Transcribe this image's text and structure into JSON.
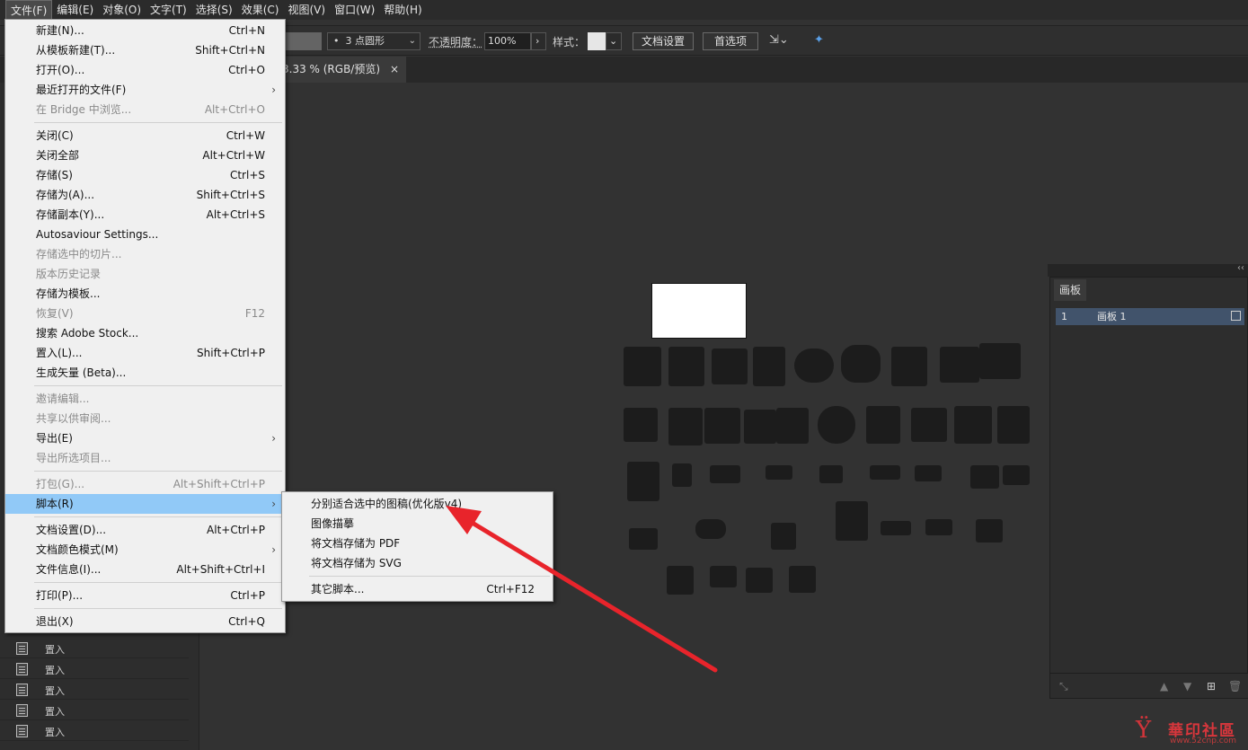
{
  "menubar": {
    "items": [
      "文件(F)",
      "编辑(E)",
      "对象(O)",
      "文字(T)",
      "选择(S)",
      "效果(C)",
      "视图(V)",
      "窗口(W)",
      "帮助(H)"
    ]
  },
  "controlbar": {
    "stroke_profile": "3 点圆形",
    "stroke_bullet": "•",
    "opacity_label": "不透明度：",
    "opacity_value": "100%",
    "style_label": "样式：",
    "doc_setup": "文档设置",
    "preferences": "首选项"
  },
  "document_tab": {
    "title": "3.33 % (RGB/预览)",
    "close": "×"
  },
  "file_menu": {
    "items": [
      {
        "label": "新建(N)...",
        "shortcut": "Ctrl+N"
      },
      {
        "label": "从模板新建(T)...",
        "shortcut": "Shift+Ctrl+N"
      },
      {
        "label": "打开(O)...",
        "shortcut": "Ctrl+O"
      },
      {
        "label": "最近打开的文件(F)",
        "shortcut": ""
      },
      {
        "label": "在 Bridge 中浏览...",
        "shortcut": "Alt+Ctrl+O"
      },
      {
        "label": "关闭(C)",
        "shortcut": "Ctrl+W"
      },
      {
        "label": "关闭全部",
        "shortcut": "Alt+Ctrl+W"
      },
      {
        "label": "存储(S)",
        "shortcut": "Ctrl+S"
      },
      {
        "label": "存储为(A)...",
        "shortcut": "Shift+Ctrl+S"
      },
      {
        "label": "存储副本(Y)...",
        "shortcut": "Alt+Ctrl+S"
      },
      {
        "label": "Autosaviour Settings...",
        "shortcut": ""
      },
      {
        "label": "存储选中的切片...",
        "shortcut": ""
      },
      {
        "label": "版本历史记录",
        "shortcut": ""
      },
      {
        "label": "存储为模板...",
        "shortcut": ""
      },
      {
        "label": "恢复(V)",
        "shortcut": "F12"
      },
      {
        "label": "搜索 Adobe Stock...",
        "shortcut": ""
      },
      {
        "label": "置入(L)...",
        "shortcut": "Shift+Ctrl+P"
      },
      {
        "label": "生成矢量 (Beta)...",
        "shortcut": ""
      },
      {
        "label": "邀请编辑...",
        "shortcut": ""
      },
      {
        "label": "共享以供审阅...",
        "shortcut": ""
      },
      {
        "label": "导出(E)",
        "shortcut": ""
      },
      {
        "label": "导出所选项目...",
        "shortcut": ""
      },
      {
        "label": "打包(G)...",
        "shortcut": "Alt+Shift+Ctrl+P"
      },
      {
        "label": "脚本(R)",
        "shortcut": ""
      },
      {
        "label": "文档设置(D)...",
        "shortcut": "Alt+Ctrl+P"
      },
      {
        "label": "文档颜色模式(M)",
        "shortcut": ""
      },
      {
        "label": "文件信息(I)...",
        "shortcut": "Alt+Shift+Ctrl+I"
      },
      {
        "label": "打印(P)...",
        "shortcut": "Ctrl+P"
      },
      {
        "label": "退出(X)",
        "shortcut": "Ctrl+Q"
      }
    ],
    "submenu_arrow": "›"
  },
  "scripts_submenu": {
    "items": [
      {
        "label": "分别适合选中的图稿(优化版v4)",
        "shortcut": ""
      },
      {
        "label": "图像描摹",
        "shortcut": ""
      },
      {
        "label": "将文档存储为 PDF",
        "shortcut": ""
      },
      {
        "label": "将文档存储为 SVG",
        "shortcut": ""
      },
      {
        "label": "其它脚本...",
        "shortcut": "Ctrl+F12"
      }
    ]
  },
  "layers_panel": {
    "rows": [
      "置入",
      "置入",
      "置入",
      "置入",
      "置入"
    ]
  },
  "artboards_panel": {
    "tab": "画板",
    "collapse": "‹‹",
    "rows": [
      {
        "number": "1",
        "name": "画板 1"
      }
    ]
  },
  "annotation": {
    "arrow_color": "#e8242b"
  },
  "watermark": {
    "logo": "Ϋ",
    "title": "華印社區",
    "url": "www.52cnp.com"
  }
}
